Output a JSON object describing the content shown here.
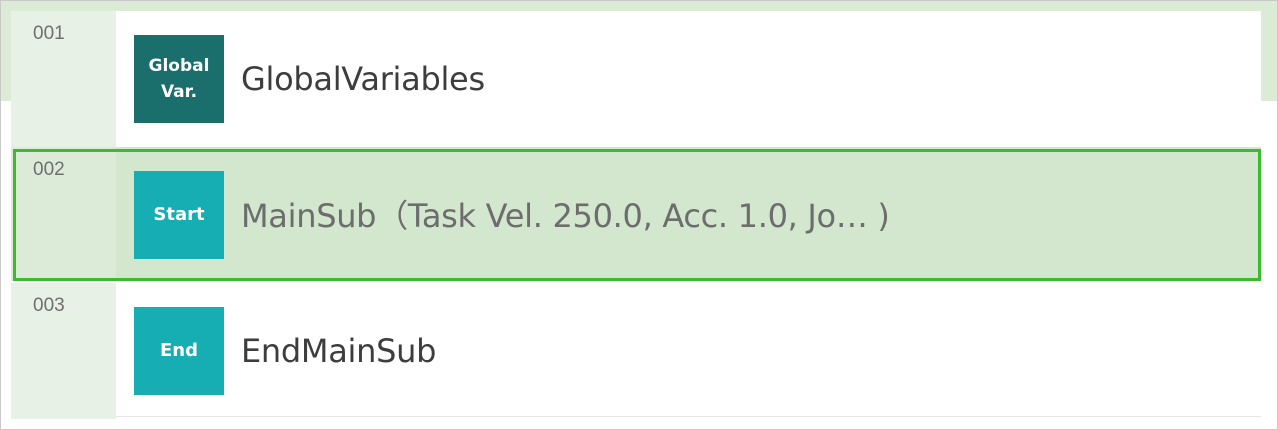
{
  "rows": [
    {
      "num": "001",
      "badge": "Global\nVar.",
      "label": "GlobalVariables",
      "badge_icon": "global-var-icon"
    },
    {
      "num": "002",
      "badge": "Start",
      "label": "MainSub（Task Vel. 250.0, Acc. 1.0, Jo… )",
      "badge_icon": "start-icon"
    },
    {
      "num": "003",
      "badge": "End",
      "label": "EndMainSub",
      "badge_icon": "end-icon"
    }
  ],
  "colors": {
    "global_badge": "#1a6e6c",
    "teal_badge": "#16adb3",
    "selection_border": "#3dbb2f",
    "selection_fill": "#d2e7cd"
  }
}
